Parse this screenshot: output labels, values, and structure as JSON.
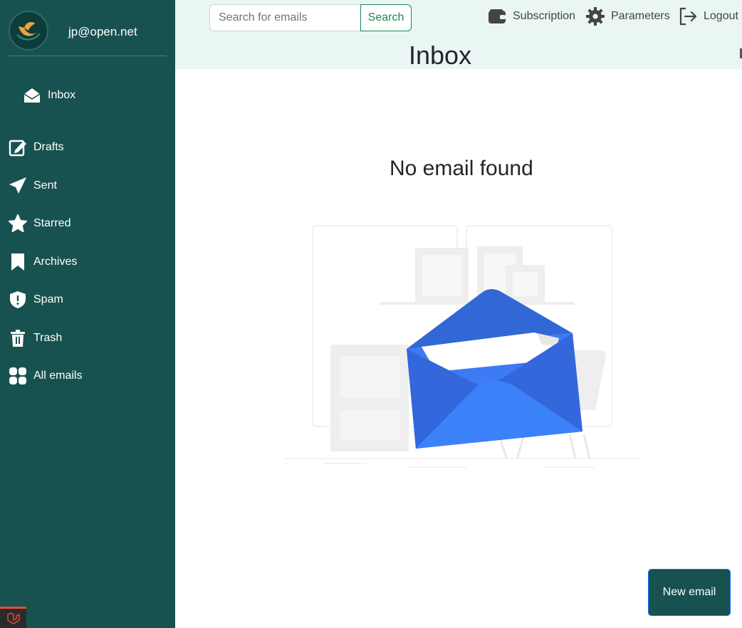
{
  "sidebar": {
    "user_email": "jp@open.net",
    "items": [
      {
        "label": "Inbox",
        "icon": "envelope-open-icon"
      },
      {
        "label": "Drafts",
        "icon": "pencil-square-icon"
      },
      {
        "label": "Sent",
        "icon": "send-icon"
      },
      {
        "label": "Starred",
        "icon": "star-icon"
      },
      {
        "label": "Archives",
        "icon": "bookmark-icon"
      },
      {
        "label": "Spam",
        "icon": "shield-exclamation-icon"
      },
      {
        "label": "Trash",
        "icon": "trash-icon"
      },
      {
        "label": "All emails",
        "icon": "grid-icon"
      }
    ]
  },
  "header": {
    "search": {
      "placeholder": "Search for emails",
      "value": "",
      "button_label": "Search"
    },
    "links": {
      "subscription": "Subscription",
      "parameters": "Parameters",
      "logout": "Logout"
    },
    "title": "Inbox"
  },
  "main": {
    "empty_message": "No email found",
    "new_email_label": "New email"
  },
  "colors": {
    "sidebar_bg": "#185250",
    "header_bg": "#eaf6f3",
    "accent_green": "#198754",
    "envelope_blue": "#3d7bf5"
  }
}
